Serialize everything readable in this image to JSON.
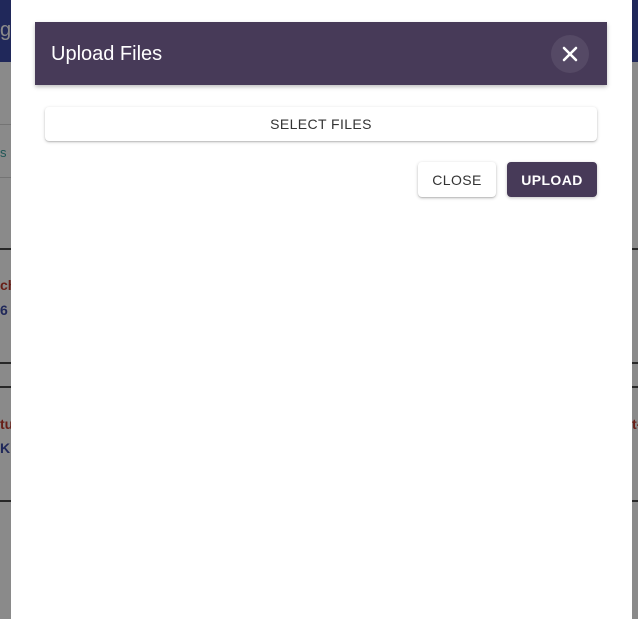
{
  "background": {
    "header_fragment": "g",
    "card_fragment": "s",
    "row1": {
      "red_fragment": "ch",
      "blue_fragment": "6"
    },
    "row2": {
      "red_fragment": "tu",
      "blue_fragment": "K",
      "right_fragment": "t-"
    }
  },
  "dialog": {
    "title": "Upload Files",
    "close_icon": "close-icon",
    "select_files_label": "SELECT FILES",
    "close_label": "CLOSE",
    "upload_label": "UPLOAD"
  },
  "colors": {
    "dialog_header": "#473a58",
    "app_header": "#3b4aa6",
    "upload_button": "#473a58"
  }
}
